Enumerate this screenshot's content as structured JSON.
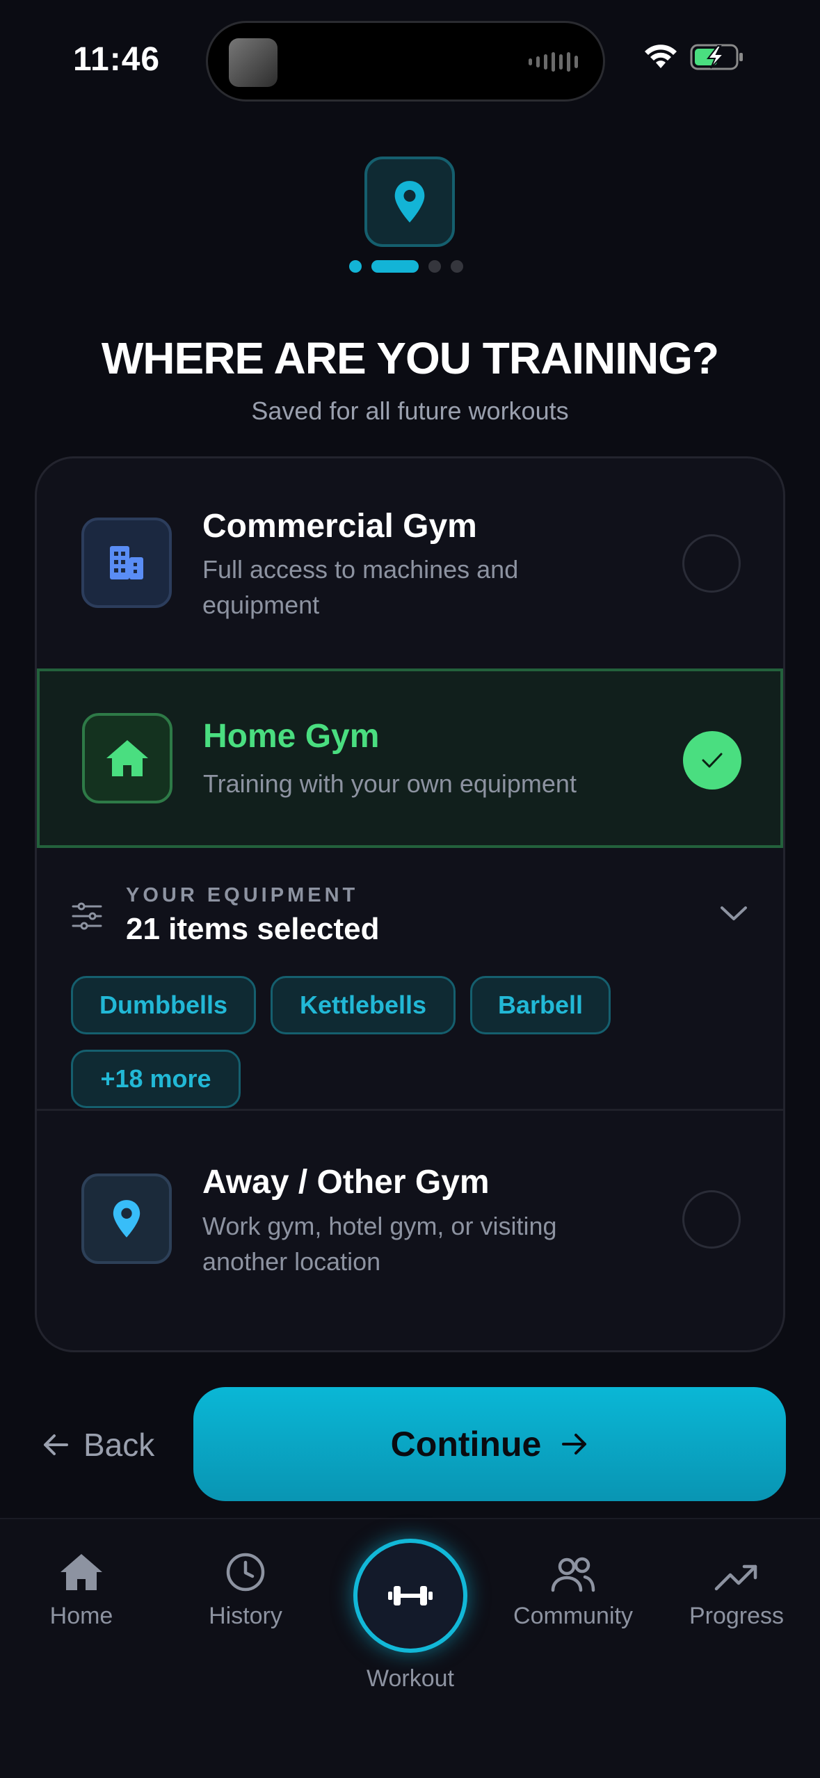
{
  "status_bar": {
    "time": "11:46"
  },
  "header": {
    "title": "WHERE ARE YOU TRAINING?",
    "subtitle": "Saved for all future workouts"
  },
  "options": [
    {
      "title": "Commercial Gym",
      "desc_line1": "Full access to machines and",
      "desc_line2": "equipment",
      "icon": "building-icon",
      "selected": false
    },
    {
      "title": "Home Gym",
      "desc_line1": "Training with your own equipment",
      "icon": "home-icon",
      "selected": true
    },
    {
      "title": "Away / Other Gym",
      "desc_line1": "Work gym, hotel gym, or visiting",
      "desc_line2": "another location",
      "icon": "location-pin-icon",
      "selected": false
    }
  ],
  "equipment": {
    "label": "YOUR EQUIPMENT",
    "count_text": "21 items selected",
    "chips": [
      "Dumbbells",
      "Kettlebells",
      "Barbell",
      "+18 more"
    ]
  },
  "actions": {
    "back_label": "Back",
    "continue_label": "Continue"
  },
  "tabs": [
    {
      "label": "Home",
      "icon": "home-icon"
    },
    {
      "label": "History",
      "icon": "clock-icon"
    },
    {
      "label": "Workout",
      "icon": "dumbbell-icon"
    },
    {
      "label": "Community",
      "icon": "users-icon"
    },
    {
      "label": "Progress",
      "icon": "trending-up-icon"
    }
  ],
  "colors": {
    "accent": "#13b4d6",
    "selected_green": "#4ade80",
    "background": "#0b0c13"
  }
}
